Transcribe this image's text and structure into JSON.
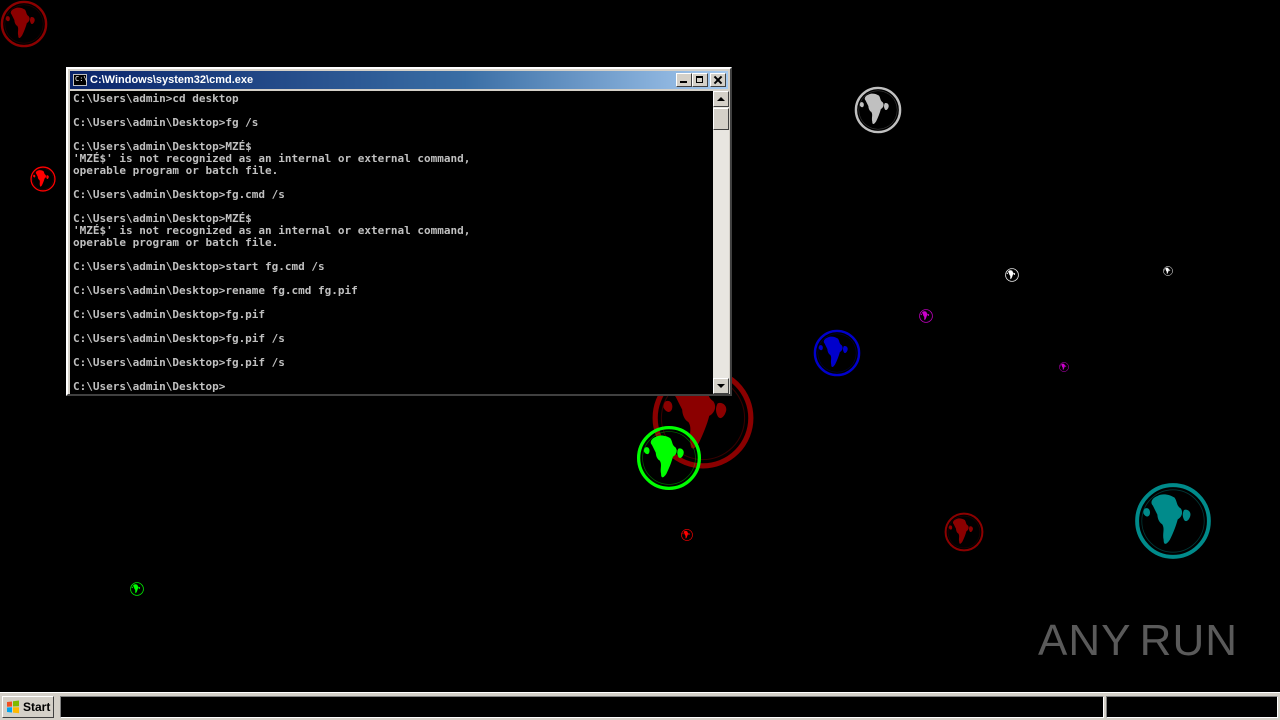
{
  "window": {
    "title": "C:\\Windows\\system32\\cmd.exe",
    "icon": "cmd-app-icon",
    "icon_text": "C:\\",
    "console_lines": [
      "C:\\Users\\admin>cd desktop",
      "",
      "C:\\Users\\admin\\Desktop>fg /s",
      "",
      "C:\\Users\\admin\\Desktop>MZÉ$",
      "'MZÉ$' is not recognized as an internal or external command,",
      "operable program or batch file.",
      "",
      "C:\\Users\\admin\\Desktop>fg.cmd /s",
      "",
      "C:\\Users\\admin\\Desktop>MZÉ$",
      "'MZÉ$' is not recognized as an internal or external command,",
      "operable program or batch file.",
      "",
      "C:\\Users\\admin\\Desktop>start fg.cmd /s",
      "",
      "C:\\Users\\admin\\Desktop>rename fg.cmd fg.pif",
      "",
      "C:\\Users\\admin\\Desktop>fg.pif",
      "",
      "C:\\Users\\admin\\Desktop>fg.pif /s",
      "",
      "C:\\Users\\admin\\Desktop>fg.pif /s",
      "",
      "C:\\Users\\admin\\Desktop>"
    ]
  },
  "taskbar": {
    "start_label": "Start",
    "start_icon": "windows-logo-icon"
  },
  "watermark": {
    "left_text": "ANY",
    "right_text": "RUN",
    "icon": "play-triangle-icon"
  },
  "desktop": {
    "background_color": "#000000",
    "globe_icon": "globe-icon",
    "globe_colors": [
      "#8b0000",
      "#c0c0c0",
      "#ff0000",
      "#ffffff",
      "#cc00cc",
      "#0000cc",
      "#00ff00",
      "#008b8b"
    ]
  }
}
